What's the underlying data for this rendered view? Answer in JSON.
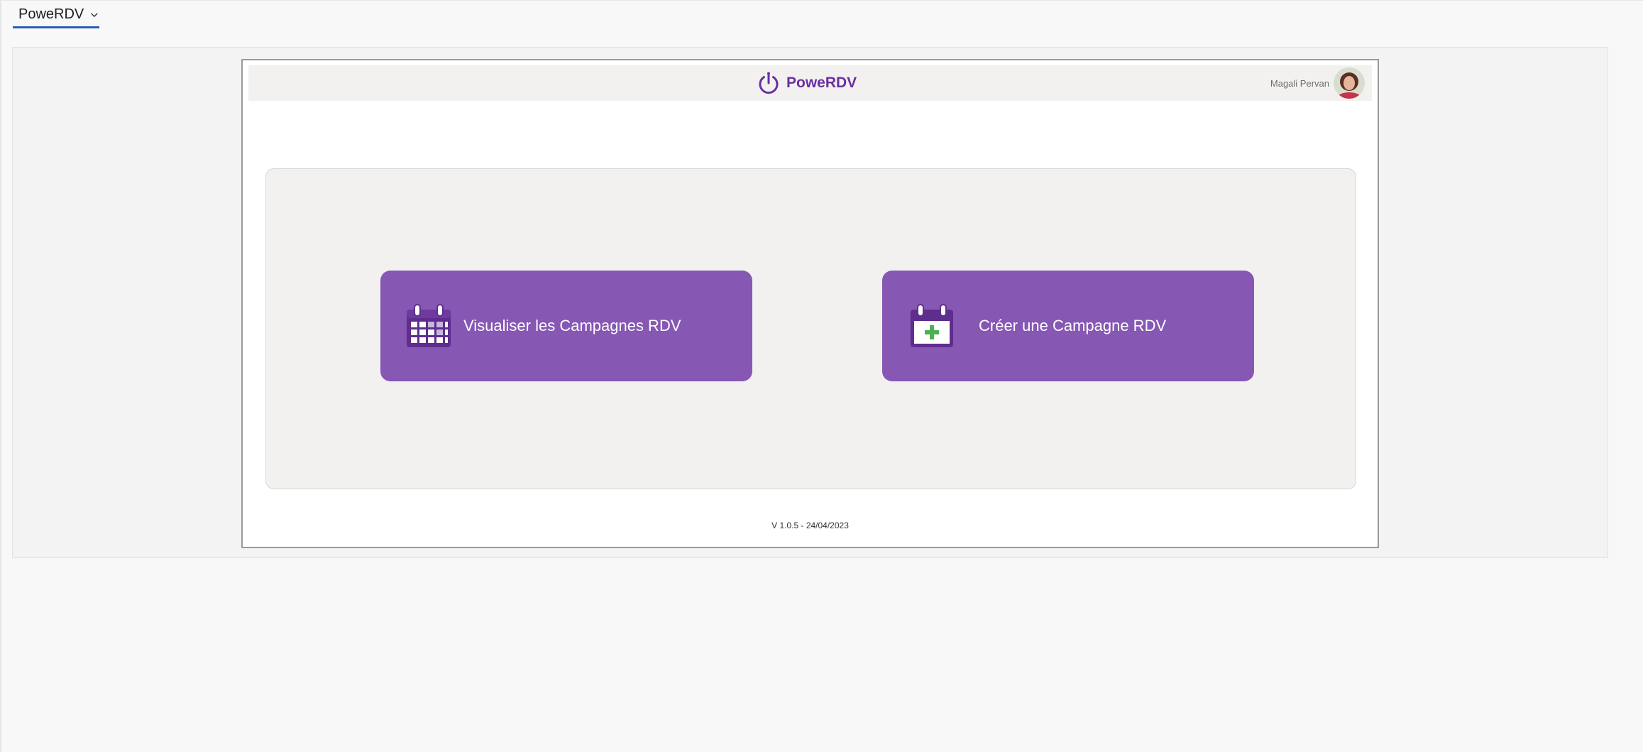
{
  "app_selector": {
    "label": "PoweRDV",
    "icon": "chevron-down-icon"
  },
  "header": {
    "brand_name": "PoweRDV",
    "brand_icon": "stopwatch-icon",
    "user_name": "Magali Pervan"
  },
  "menu": {
    "view_label": "Visualiser les Campagnes RDV",
    "view_icon": "calendar-grid-icon",
    "create_label": "Créer une Campagne RDV",
    "create_icon": "calendar-add-icon"
  },
  "footer": {
    "version": "V 1.0.5 - 24/04/2023"
  },
  "colors": {
    "brand": "#6a2fa0",
    "button": "#8657b3",
    "plus": "#4caf50",
    "selector_underline": "#2b5fb4"
  }
}
